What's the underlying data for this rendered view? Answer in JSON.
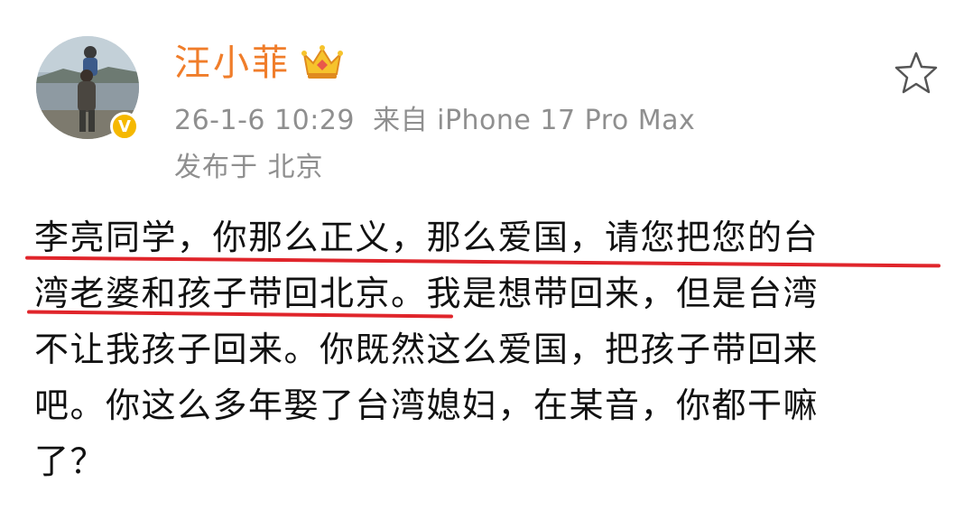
{
  "post": {
    "author": "汪小菲",
    "timestamp": "26-1-6 10:29",
    "source": "来自 iPhone 17 Pro Max",
    "location": "发布于 北京",
    "verified_badge": "V",
    "lines": [
      "李亮同学，你那么正义，那么爱国，请您把您的台",
      "湾老婆和孩子带回北京。我是想带回来，但是台湾",
      "不让我孩子回来。你既然这么爱国，把孩子带回来",
      "吧。你这么多年娶了台湾媳妇，在某音，你都干嘛",
      "了？"
    ],
    "icons": {
      "avatar": "avatar-photo",
      "verified": "verified-badge-icon",
      "crown": "crown-icon",
      "favorite": "star-icon"
    },
    "colors": {
      "name": "#f07d2a",
      "meta": "#8f8f8f",
      "text": "#111111",
      "underline": "#e0252b",
      "badge": "#f5b800"
    }
  }
}
